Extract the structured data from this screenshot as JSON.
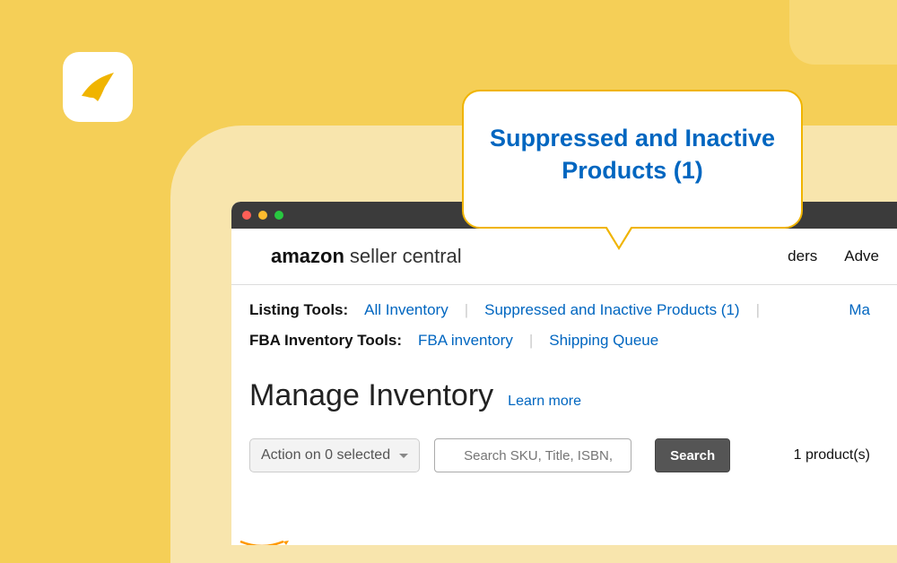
{
  "brand": {
    "part1": "amazon",
    "part2": "seller central"
  },
  "nav_tail": {
    "item1": "ders",
    "item2": "Adve"
  },
  "listing_tools": {
    "label": "Listing Tools:",
    "all_inventory": "All Inventory",
    "suppressed": "Suppressed and Inactive Products (1)",
    "tail": "Ma"
  },
  "fba_tools": {
    "label": "FBA Inventory Tools:",
    "fba_inventory": "FBA inventory",
    "shipping_queue": "Shipping Queue"
  },
  "page_heading": {
    "title": "Manage Inventory",
    "learn": "Learn more"
  },
  "action_bar": {
    "action_label": "Action on 0 selected",
    "search_placeholder": "Search SKU, Title, ISBN,",
    "search_button": "Search",
    "count": "1 product(s)"
  },
  "callout": {
    "text": "Suppressed and Inactive Products (1)"
  }
}
